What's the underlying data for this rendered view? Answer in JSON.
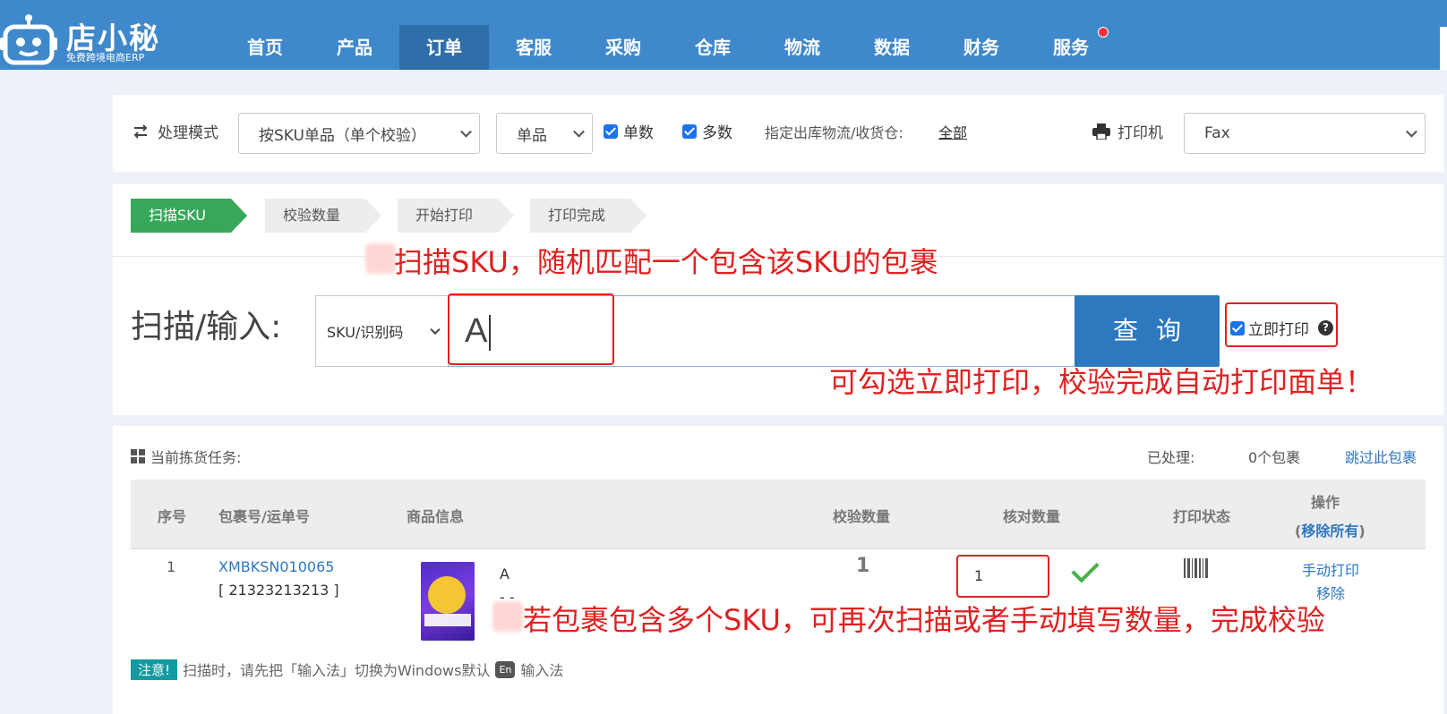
{
  "brand": {
    "name": "店小秘",
    "tagline": "免费跨境电商ERP"
  },
  "nav": {
    "items": [
      "首页",
      "产品",
      "订单",
      "客服",
      "采购",
      "仓库",
      "物流",
      "数据",
      "财务",
      "服务"
    ]
  },
  "settings": {
    "mode_label": "处理模式",
    "mode_select": "按SKU单品（单个校验）",
    "single_select": "单品",
    "count_checkbox": "单数",
    "multi_checkbox": "多数",
    "warehouse_label": "指定出库物流/收货仓:",
    "warehouse_value": "全部",
    "printer_label": "打印机",
    "printer_select": "Fax"
  },
  "steps": [
    "扫描SKU",
    "校验数量",
    "开始打印",
    "打印完成"
  ],
  "scan": {
    "label": "扫描/输入:",
    "type_select": "SKU/识别码",
    "input_value": "A",
    "query_button": "查询",
    "instant_print": "立即打印",
    "help_glyph": "?"
  },
  "annotations": {
    "scan_tip": "扫描SKU，随机匹配一个包含该SKU的包裹",
    "print_tip": "可勾选立即打印，校验完成自动打印面单！",
    "multi_tip": "若包裹包含多个SKU，可再次扫描或者手动填写数量，完成校验"
  },
  "task": {
    "title": "当前拣货任务:",
    "processed_label": "已处理:",
    "processed_value": "0个包裹",
    "skip_link": "跳过此包裹",
    "columns": {
      "index": "序号",
      "package_no": "包裹号/运单号",
      "product_info": "商品信息",
      "check_qty": "校验数量",
      "verify_qty": "核对数量",
      "print_status": "打印状态",
      "action": "操作",
      "remove_all": "移除所有"
    },
    "rows": [
      {
        "index": "1",
        "package_no": "XMBKSN010065",
        "tracking_no": "[ 21323213213 ]",
        "product_sku": "A",
        "product_variant": "- -",
        "check_qty": "1",
        "verify_qty": "1",
        "manual_print": "手动打印",
        "remove": "移除"
      }
    ]
  },
  "notice": {
    "tag": "注意!",
    "text_before": "扫描时，请先把「输入法」切换为Windows默认",
    "en_key": "En",
    "text_after": "输入法"
  },
  "colors": {
    "nav_bg": "#3f88cc",
    "nav_active": "#2f6fa9",
    "step_active": "#37a85a",
    "query_button": "#2e78c0",
    "annotation_red": "#e02020",
    "notice_tag": "#129aa0"
  }
}
